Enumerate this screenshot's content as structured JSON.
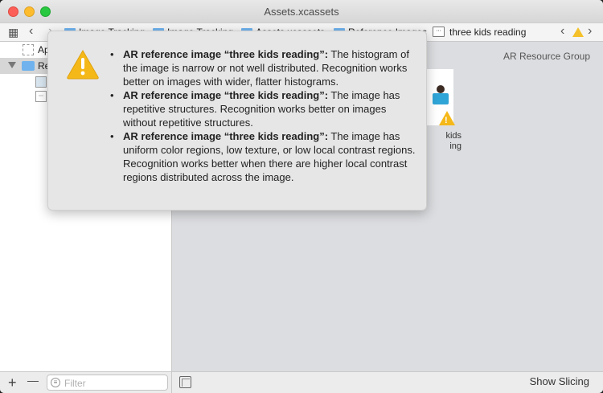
{
  "window": {
    "title": "Assets.xcassets"
  },
  "jumpbar": {
    "breadcrumbs": [
      "Image Tracking",
      "Image Tracking",
      "Assets.xcassets",
      "Reference Images",
      "three kids reading"
    ]
  },
  "sidebar": {
    "items": [
      {
        "label": "Ap",
        "type": "appicon"
      },
      {
        "label": "Re",
        "type": "folder"
      },
      {
        "label": "",
        "type": "image"
      },
      {
        "label": "",
        "type": "image"
      }
    ]
  },
  "filter": {
    "placeholder": "Filter"
  },
  "main": {
    "group_label": "AR Resource Group",
    "asset_caption_line1": "kids",
    "asset_caption_line2": "ing"
  },
  "bottom": {
    "show_slicing": "Show Slicing",
    "add": "+",
    "remove": "—"
  },
  "popover": {
    "issues": [
      {
        "title": "AR reference image “three kids reading”:",
        "detail": " The histogram of the image is narrow or not well distributed. Recognition works better on images with wider, flatter histograms."
      },
      {
        "title": "AR reference image “three kids reading”:",
        "detail": " The image has repetitive structures. Recognition works better on images without repetitive structures."
      },
      {
        "title": "AR reference image “three kids reading”:",
        "detail": " The image has uniform color regions, low texture, or low local contrast regions. Recognition works better when there are higher local contrast regions distributed across the image."
      }
    ]
  },
  "colors": {
    "warning": "#f5b819",
    "folder": "#6fb2ee"
  }
}
